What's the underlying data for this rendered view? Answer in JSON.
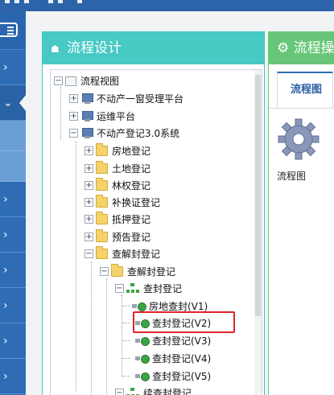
{
  "sidebar": {
    "items": [
      {
        "label": "›"
      },
      {
        "label": "⌄"
      },
      {
        "label": "›"
      },
      {
        "label": "›"
      },
      {
        "label": "›"
      },
      {
        "label": "›"
      },
      {
        "label": "›"
      },
      {
        "label": "›"
      }
    ]
  },
  "left_panel": {
    "title": "流程设计",
    "icon": "gift-icon",
    "tree": [
      {
        "label": "流程视图",
        "level": 0,
        "toggle": "−",
        "icon": "root"
      },
      {
        "label": "不动产一窗受理平台",
        "level": 1,
        "toggle": "+",
        "icon": "computer"
      },
      {
        "label": "运维平台",
        "level": 1,
        "toggle": "+",
        "icon": "computer"
      },
      {
        "label": "不动产登记3.0系统",
        "level": 1,
        "toggle": "−",
        "icon": "computer"
      },
      {
        "label": "房地登记",
        "level": 2,
        "toggle": "+",
        "icon": "folder"
      },
      {
        "label": "土地登记",
        "level": 2,
        "toggle": "+",
        "icon": "folder"
      },
      {
        "label": "林权登记",
        "level": 2,
        "toggle": "+",
        "icon": "folder"
      },
      {
        "label": "补换证登记",
        "level": 2,
        "toggle": "+",
        "icon": "folder"
      },
      {
        "label": "抵押登记",
        "level": 2,
        "toggle": "+",
        "icon": "folder"
      },
      {
        "label": "预告登记",
        "level": 2,
        "toggle": "+",
        "icon": "folder"
      },
      {
        "label": "查解封登记",
        "level": 2,
        "toggle": "−",
        "icon": "folder"
      },
      {
        "label": "查解封登记",
        "level": 3,
        "toggle": "−",
        "icon": "folder"
      },
      {
        "label": "查封登记",
        "level": 4,
        "toggle": "−",
        "icon": "flow"
      },
      {
        "label": "房地查封(V1)",
        "level": 5,
        "toggle": "",
        "icon": "process"
      },
      {
        "label": "查封登记(V2)",
        "level": 5,
        "toggle": "",
        "icon": "process",
        "selected": true
      },
      {
        "label": "查封登记(V3)",
        "level": 5,
        "toggle": "",
        "icon": "process"
      },
      {
        "label": "查封登记(V4)",
        "level": 5,
        "toggle": "",
        "icon": "process"
      },
      {
        "label": "查封登记(V5)",
        "level": 5,
        "toggle": "",
        "icon": "process"
      },
      {
        "label": "续查封登记",
        "level": 4,
        "toggle": "−",
        "icon": "flow"
      }
    ]
  },
  "right_panel": {
    "title": "流程操",
    "icon": "cogs-icon",
    "tab": "流程图",
    "item_label": "流程图"
  }
}
